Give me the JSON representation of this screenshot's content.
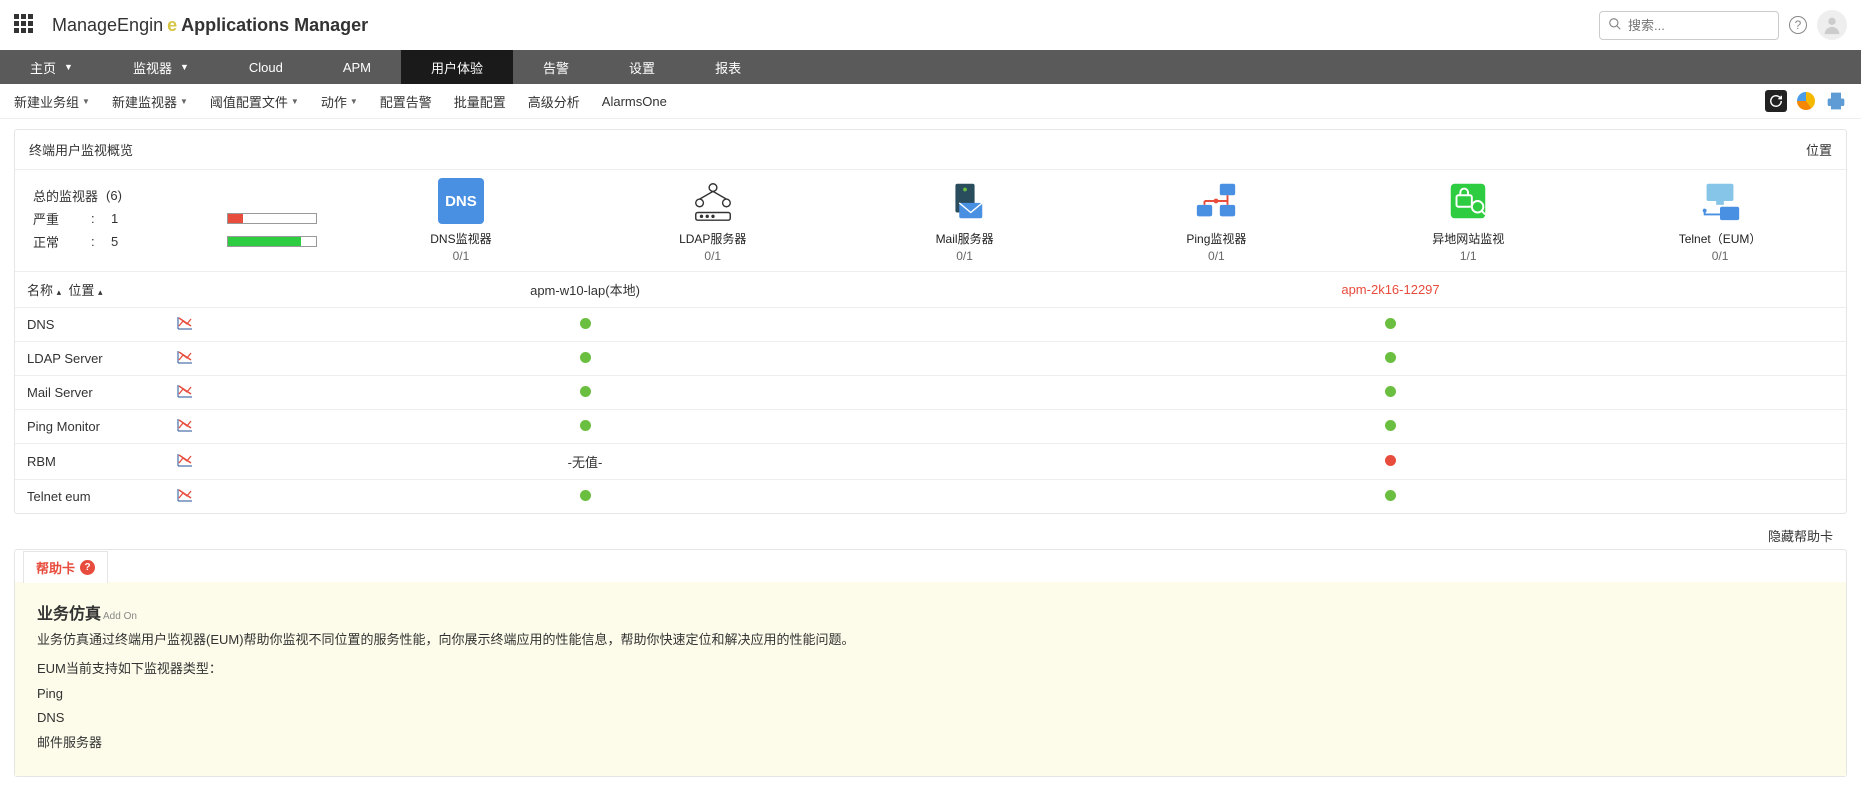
{
  "brand": {
    "me": "ManageEngin",
    "logo": "e",
    "app": "Applications Manager"
  },
  "search": {
    "placeholder": "搜索..."
  },
  "nav": {
    "items": [
      "主页",
      "监视器",
      "Cloud",
      "APM",
      "用户体验",
      "告警",
      "设置",
      "报表"
    ],
    "dropdowns": [
      true,
      true,
      false,
      false,
      false,
      false,
      false,
      false
    ],
    "active": 4
  },
  "subnav": {
    "items": [
      "新建业务组",
      "新建监视器",
      "阈值配置文件",
      "动作",
      "配置告警",
      "批量配置",
      "高级分析",
      "AlarmsOne"
    ],
    "dropdowns": [
      true,
      true,
      true,
      true,
      false,
      false,
      false,
      false
    ]
  },
  "overview": {
    "title": "终端用户监视概览",
    "location_link": "位置",
    "summary": {
      "total_label": "总的监视器",
      "total_count": "(6)",
      "critical_label": "严重",
      "critical_count": "1",
      "critical_pct": 17,
      "normal_label": "正常",
      "normal_count": "5",
      "normal_pct": 83
    },
    "cards": [
      {
        "id": "dns",
        "label": "DNS监视器",
        "count": "0/1"
      },
      {
        "id": "ldap",
        "label": "LDAP服务器",
        "count": "0/1"
      },
      {
        "id": "mail",
        "label": "Mail服务器",
        "count": "0/1"
      },
      {
        "id": "ping",
        "label": "Ping监视器",
        "count": "0/1"
      },
      {
        "id": "rbm",
        "label": "异地网站监视",
        "count": "1/1"
      },
      {
        "id": "telnet",
        "label": "Telnet（EUM）",
        "count": "0/1"
      }
    ]
  },
  "table": {
    "headers": {
      "name": "名称",
      "loc": "位置",
      "col1": "apm-w10-lap(本地)",
      "col2": "apm-2k16-12297"
    },
    "rows": [
      {
        "name": "DNS",
        "c1": "green",
        "c2": "green"
      },
      {
        "name": "LDAP Server",
        "c1": "green",
        "c2": "green"
      },
      {
        "name": "Mail Server",
        "c1": "green",
        "c2": "green"
      },
      {
        "name": "Ping Monitor",
        "c1": "green",
        "c2": "green"
      },
      {
        "name": "RBM",
        "c1": "text:-无值-",
        "c2": "red"
      },
      {
        "name": "Telnet eum",
        "c1": "green",
        "c2": "green"
      }
    ]
  },
  "help": {
    "hide": "隐藏帮助卡",
    "tab": "帮助卡",
    "title": "业务仿真",
    "addon": "Add On",
    "p1": "业务仿真通过终端用户监视器(EUM)帮助你监视不同位置的服务性能，向你展示终端应用的性能信息，帮助你快速定位和解决应用的性能问题。",
    "p2": "EUM当前支持如下监视器类型：",
    "list": [
      "Ping",
      "DNS",
      "邮件服务器"
    ]
  }
}
